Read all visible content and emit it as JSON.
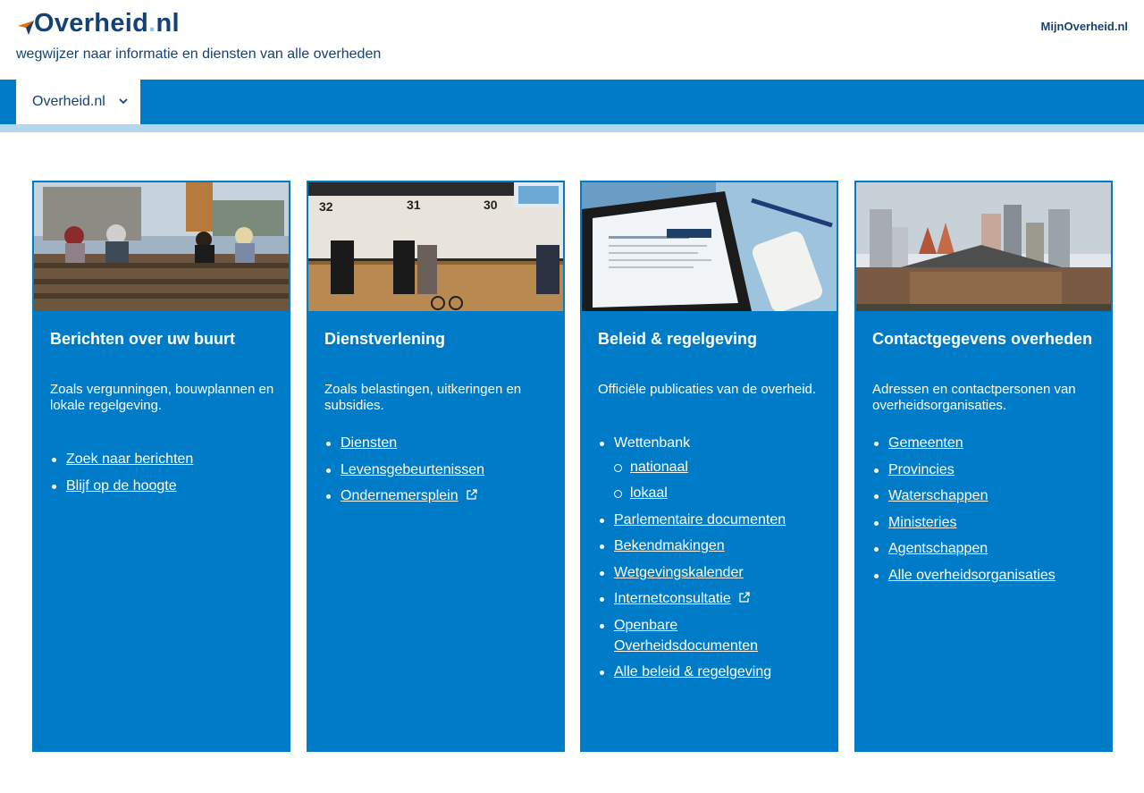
{
  "header": {
    "logo_main": "Overheid",
    "logo_dot": ".",
    "logo_tld": "nl",
    "tagline": "wegwijzer naar informatie en diensten van alle overheden",
    "mijn_link": "MijnOverheid.nl"
  },
  "nav": {
    "tab_label": "Overheid.nl",
    "tab_icon": "chevron-down-icon"
  },
  "colors": {
    "brand_blue": "#007bc7",
    "dark_blue": "#154273",
    "light_strip": "#b2d7ee"
  },
  "cards": [
    {
      "title": "Berichten over uw buurt",
      "desc": "Zoals vergunningen, bouwplannen en lokale regelgeving.",
      "links": [
        "Zoek naar berichten",
        "Blijf op de hoogte"
      ]
    },
    {
      "title": "Dienstverlening",
      "desc": "Zoals belastingen, uitkeringen en subsidies.",
      "links": [
        "Diensten",
        "Levensgebeurtenissen",
        "Ondernemersplein"
      ],
      "external_icon": "external-link-icon"
    },
    {
      "title": "Beleid & regelgeving",
      "desc": "Officiële publicaties van de overheid.",
      "wettenbank": "Wettenbank",
      "sublinks": [
        "nationaal",
        "lokaal"
      ],
      "links": [
        "Parlementaire documenten",
        "Bekendmakingen",
        "Wetgevingskalender",
        "Internetconsultatie",
        "Openbare Overheidsdocumenten",
        "Alle beleid & regelgeving"
      ]
    },
    {
      "title": "Contactgegevens overheden",
      "desc": "Adressen en contactpersonen van overheidsorganisaties.",
      "links": [
        "Gemeenten",
        "Provincies",
        "Waterschappen",
        "Ministeries",
        "Agentschappen",
        "Alle overheidsorganisaties"
      ]
    }
  ]
}
